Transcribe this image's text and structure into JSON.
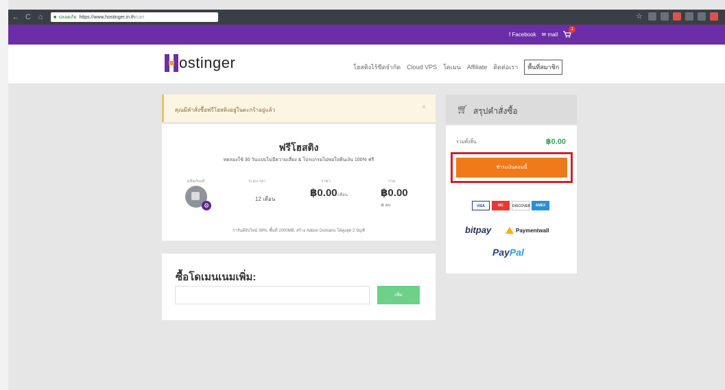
{
  "browser": {
    "back": "←",
    "reload": "C",
    "home": "⌂",
    "secure_label": "ปลอดภัย",
    "url_host": "https://www.hostinger.in.th",
    "url_path": "/cart"
  },
  "topbar": {
    "facebook": "f Facebook",
    "mail": "✉ mail",
    "cart_count": "1"
  },
  "header": {
    "logo": "ostinger",
    "nav": [
      "โฮสติงไร้ขีดจำกัด",
      "Cloud VPS",
      "โดเมน",
      "Affiliate",
      "ติดต่อเรา"
    ],
    "member_button": "พื้นที่สมาชิก"
  },
  "alert": {
    "text": "คุณมีคำสั่งซื้อฟรีโฮสติงอยู่ในตะกร้าอยู่แล้ว",
    "close": "×"
  },
  "product": {
    "title": "ฟรีโฮสติง",
    "subtitle": "ทดลองใช้ 30 วันแบบไม่มีความเสี่ยง & โปรแกรมไม่พอใจคืนเงิน 100% ฟรี",
    "col_product": "ผลิตภัณฑ์",
    "col_period": "ระยะเวลา",
    "col_price": "ราคา",
    "col_total": "รวม",
    "duration": "12 เดือน",
    "price": "฿0.00",
    "price_unit": "/เดือน",
    "total": "฿0.00",
    "remove": "⊗ ลบ",
    "footer": "การันตีอัปไทม์ 99%, พื้นที่ 2000MB, สร้าง Addon Domains ได้สูงสุด 2 บัญชี"
  },
  "domain": {
    "title": "ซื้อโดเมนเนมเพิ่ม:",
    "placeholder": "",
    "button": "เพิ่ม"
  },
  "summary": {
    "title": "สรุปคำสั่งซื้อ",
    "total_label": "รวมทั้งสิ้น",
    "total_value": "฿0.00",
    "checkout_button": "ชำระเงินตอนนี้",
    "cards": [
      "VISA",
      "MC",
      "DISCOVER",
      "AMEX"
    ],
    "bitpay": "bitpay",
    "paymentwall": "Paymentwall",
    "paypal_pay": "Pay",
    "paypal_pal": "Pal"
  },
  "colors": {
    "brand_purple": "#6b2ea6",
    "checkout_orange": "#f07a1a",
    "highlight_red": "#d0202a",
    "total_green": "#3aa45b",
    "domain_button_green": "#6ed089"
  }
}
